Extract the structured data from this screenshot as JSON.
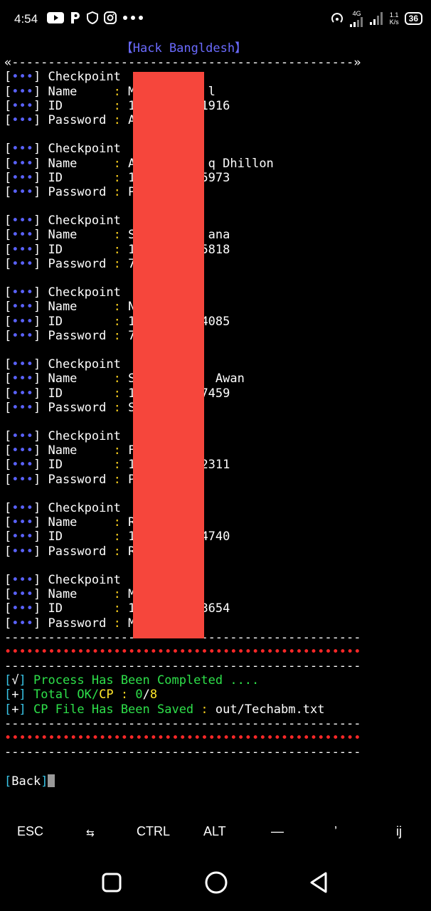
{
  "status_bar": {
    "time": "4:54",
    "net_label": "4G",
    "speed": "1.1\nK/s",
    "battery": "36"
  },
  "terminal": {
    "title": "【Hack Bangldesh】",
    "top_divider": "«-----------------------------------------------»",
    "entry_label": "Checkpoint",
    "labels": {
      "name": "Name     ",
      "id": "ID       ",
      "password": "Password "
    },
    "entries": [
      {
        "name": "M          l",
        "id": "1         1916",
        "password": "A"
      },
      {
        "name": "A          q Dhillon",
        "id": "1         5973",
        "password": "P"
      },
      {
        "name": "S          ana",
        "id": "1         5818",
        "password": "7"
      },
      {
        "name": "N",
        "id": "1         4085",
        "password": "7"
      },
      {
        "name": "S           Awan",
        "id": "1         7459",
        "password": "S"
      },
      {
        "name": "F",
        "id": "1         2311",
        "password": "P"
      },
      {
        "name": "R",
        "id": "1         4740",
        "password": "R"
      },
      {
        "name": "M",
        "id": "1         3654",
        "password": "M"
      }
    ],
    "dash_line": "-------------------------------------------------",
    "dot_line": "•••••••••••••••••••••••••••••••••••••••••••••••••",
    "process_mark": "√",
    "process_text": "Process Has Been Completed ....",
    "total_mark": "+",
    "total_label": "Total OK/",
    "total_cp": "CP",
    "total_ok_value": "0",
    "total_slash": "/",
    "total_cp_value": "8",
    "saved_mark": "+",
    "saved_label": "CP File Has Been Saved",
    "saved_path": "out/Techabm.txt",
    "back_label": "Back"
  },
  "extra_keys": {
    "esc": "ESC",
    "tab": "⇆",
    "ctrl": "CTRL",
    "alt": "ALT",
    "dash": "—",
    "apos": "’",
    "ij": "ij"
  },
  "colors": {
    "redaction": "#f6463c",
    "dots": "#5a62ff",
    "colon": "#ffd21e",
    "green": "#2ee04a",
    "cyan": "#39c5e8"
  }
}
